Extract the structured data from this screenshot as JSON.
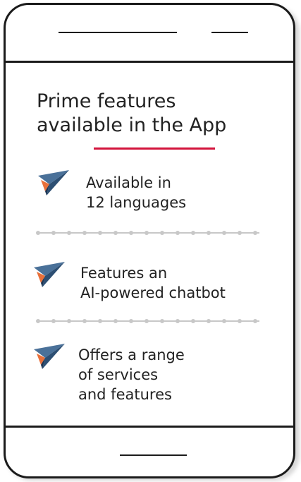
{
  "screen": {
    "title": "Prime features\navailable in the App"
  },
  "features": [
    {
      "icon": "paper-plane-icon",
      "text": "Available in\n12 languages"
    },
    {
      "icon": "paper-plane-icon",
      "text": "Features an\nAI-powered chatbot"
    },
    {
      "icon": "paper-plane-icon",
      "text": "Offers a range\nof services\nand features"
    }
  ],
  "colors": {
    "accent": "#d3143c",
    "plane_dark": "#2d4f73",
    "plane_light": "#4a7199",
    "plane_orange": "#e8703a",
    "frame": "#1b1b1b",
    "divider": "#c8c8c8"
  }
}
